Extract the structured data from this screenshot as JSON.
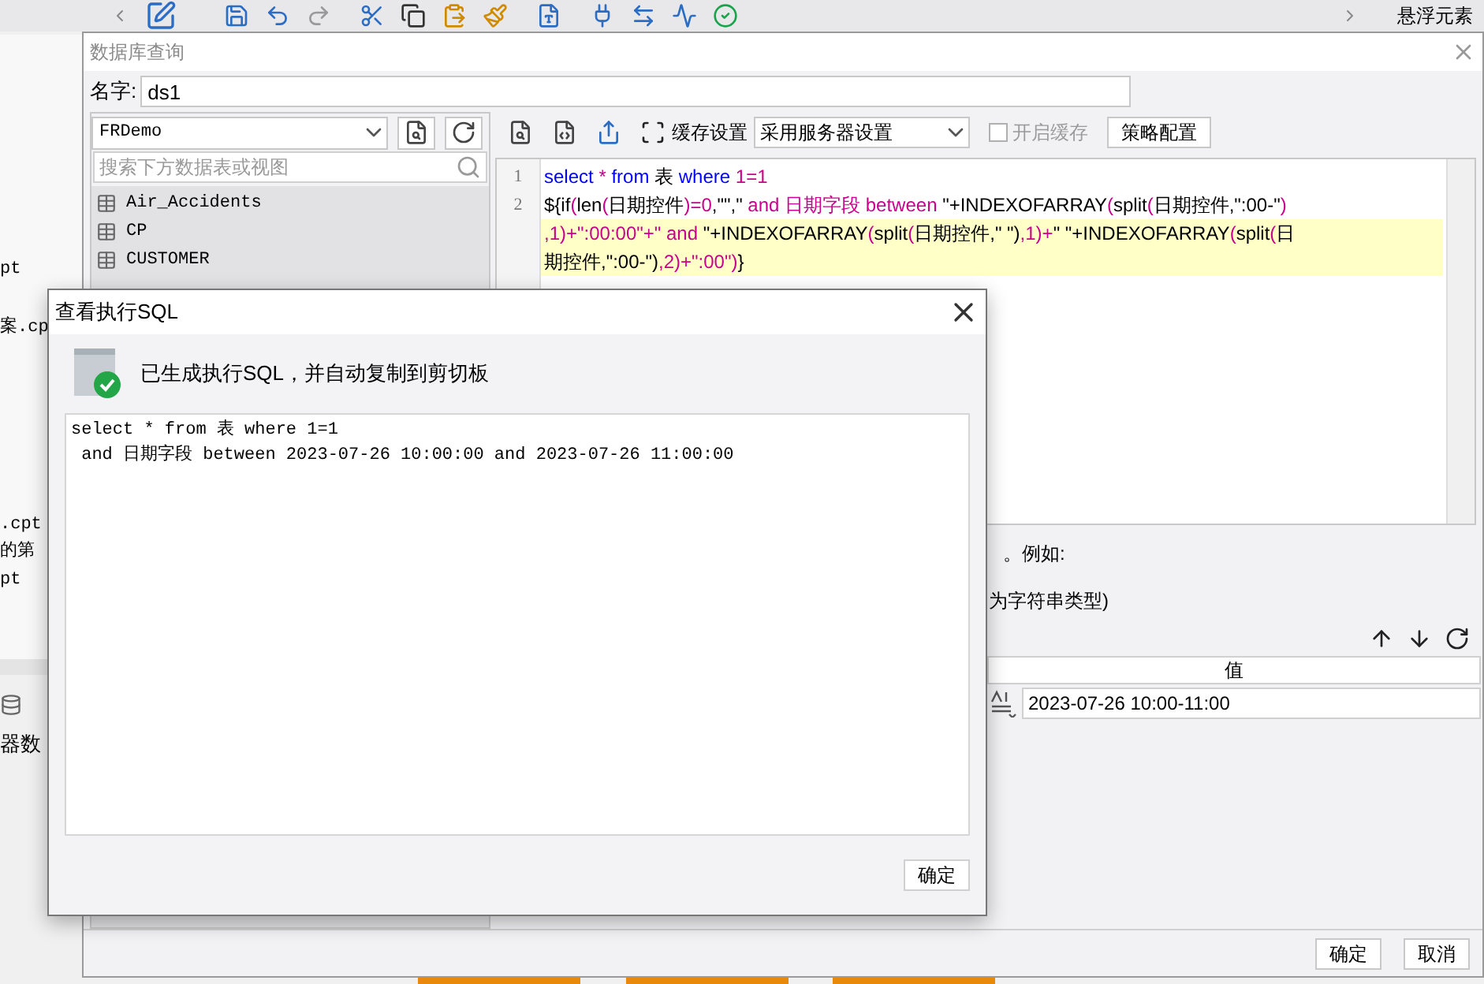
{
  "background_app": {
    "floating_panel_title": "悬浮元素",
    "file_fragments": [
      "pt",
      "案.cp",
      ".cpt",
      "的第",
      "pt"
    ],
    "dataset_label": "器数"
  },
  "query_dialog": {
    "title": "数据库查询",
    "name_label": "名字:",
    "name_value": "ds1",
    "connection": "FRDemo",
    "search_placeholder": "搜索下方数据表或视图",
    "tables": [
      {
        "name": "Air_Accidents"
      },
      {
        "name": "CP"
      },
      {
        "name": "CUSTOMER"
      }
    ],
    "cache_label": "缓存设置",
    "cache_mode": "采用服务器设置",
    "enable_cache": {
      "label": "开启缓存",
      "checked": false,
      "disabled": true
    },
    "strategy_button": "策略配置",
    "editor": {
      "lines": [
        {
          "number": "1",
          "rows": [
            {
              "highlighted": false,
              "segments": [
                {
                  "kind": "keyword",
                  "text": "select"
                },
                {
                  "kind": "symbol",
                  "text": " * "
                },
                {
                  "kind": "keyword",
                  "text": "from"
                },
                {
                  "kind": "plain",
                  "text": " 表 "
                },
                {
                  "kind": "keyword",
                  "text": "where"
                },
                {
                  "kind": "symbol",
                  "text": " 1=1"
                }
              ]
            }
          ]
        },
        {
          "number": "2",
          "rows": [
            {
              "highlighted": false,
              "segments": [
                {
                  "kind": "plain",
                  "text": "${if"
                },
                {
                  "kind": "symbol",
                  "text": "("
                },
                {
                  "kind": "plain",
                  "text": "len"
                },
                {
                  "kind": "symbol",
                  "text": "("
                },
                {
                  "kind": "plain",
                  "text": "日期控件"
                },
                {
                  "kind": "symbol",
                  "text": ")=0"
                },
                {
                  "kind": "plain",
                  "text": ",\"\",\""
                },
                {
                  "kind": "symbol",
                  "text": " and 日期字段 between "
                },
                {
                  "kind": "plain",
                  "text": "\"+INDEXOFARRAY"
                },
                {
                  "kind": "symbol",
                  "text": "("
                },
                {
                  "kind": "plain",
                  "text": "split"
                },
                {
                  "kind": "symbol",
                  "text": "("
                },
                {
                  "kind": "plain",
                  "text": "日期控件,\":00-\""
                },
                {
                  "kind": "symbol",
                  "text": ")"
                }
              ]
            },
            {
              "highlighted": true,
              "segments": [
                {
                  "kind": "symbol",
                  "text": ",1)+\":00:00\"+\" and "
                },
                {
                  "kind": "plain",
                  "text": "\"+INDEXOFARRAY"
                },
                {
                  "kind": "symbol",
                  "text": "("
                },
                {
                  "kind": "plain",
                  "text": "split"
                },
                {
                  "kind": "symbol",
                  "text": "("
                },
                {
                  "kind": "plain",
                  "text": "日期控件,\" \")"
                },
                {
                  "kind": "symbol",
                  "text": ",1)+"
                },
                {
                  "kind": "plain",
                  "text": "\" \"+INDEXOFARRAY"
                },
                {
                  "kind": "symbol",
                  "text": "("
                },
                {
                  "kind": "plain",
                  "text": "split"
                },
                {
                  "kind": "symbol",
                  "text": "("
                },
                {
                  "kind": "plain",
                  "text": "日"
                }
              ]
            },
            {
              "highlighted": true,
              "segments": [
                {
                  "kind": "plain",
                  "text": "期控件,\":00-\")"
                },
                {
                  "kind": "symbol",
                  "text": ",2)+\":00\")"
                },
                {
                  "kind": "plain",
                  "text": "}"
                }
              ]
            }
          ]
        }
      ]
    },
    "hint_lines": [
      "。例如:",
      "为字符串类型)"
    ],
    "parameters_table": {
      "header": "值",
      "rows": [
        {
          "value": "2023-07-26 10:00-11:00"
        }
      ]
    },
    "buttons": [
      "确定",
      "取消"
    ]
  },
  "sql_dialog": {
    "title": "查看执行SQL",
    "message": "已生成执行SQL，并自动复制到剪切板",
    "sql_lines": [
      "select * from 表 where 1=1",
      " and 日期字段 between 2023-07-26 10:00:00 and 2023-07-26 11:00:00"
    ],
    "button": "确定"
  }
}
